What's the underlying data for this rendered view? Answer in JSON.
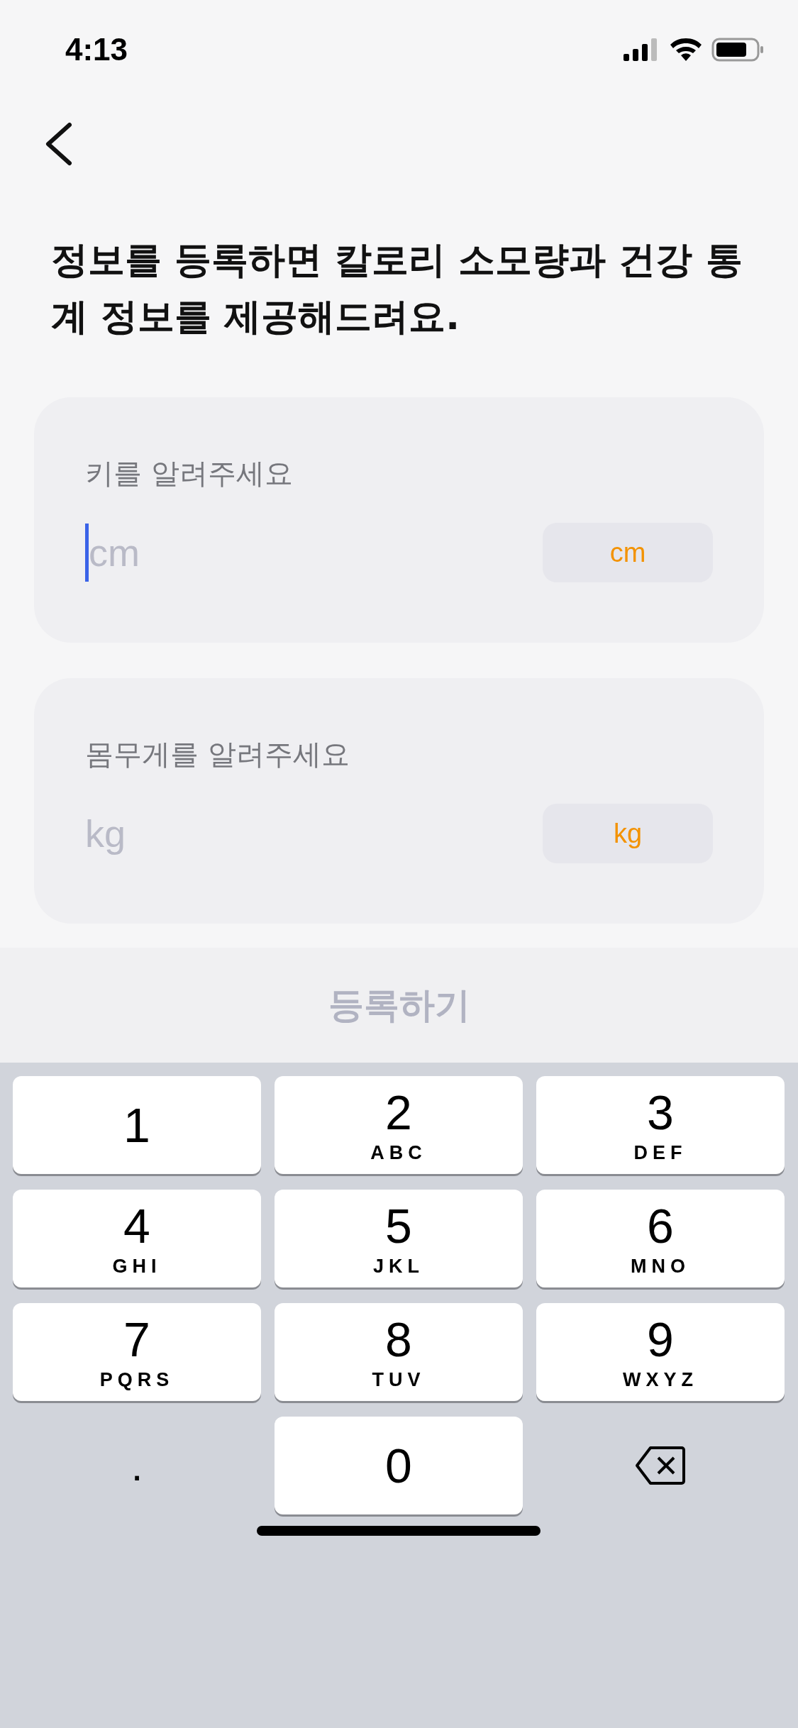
{
  "status_bar": {
    "time": "4:13"
  },
  "title": "정보를 등록하면 칼로리 소모량과 건강 통계 정보를 제공해드려요.",
  "fields": [
    {
      "label": "키를 알려주세요",
      "placeholder": "cm",
      "unit": "cm",
      "focused": true
    },
    {
      "label": "몸무게를 알려주세요",
      "placeholder": "kg",
      "unit": "kg",
      "focused": false
    }
  ],
  "submit": {
    "label": "등록하기",
    "disabled": true
  },
  "keypad": [
    {
      "kind": "digit",
      "digit": "1"
    },
    {
      "kind": "digit",
      "digit": "2",
      "letters": "ABC"
    },
    {
      "kind": "digit",
      "digit": "3",
      "letters": "DEF"
    },
    {
      "kind": "digit",
      "digit": "4",
      "letters": "GHI"
    },
    {
      "kind": "digit",
      "digit": "5",
      "letters": "JKL"
    },
    {
      "kind": "digit",
      "digit": "6",
      "letters": "MNO"
    },
    {
      "kind": "digit",
      "digit": "7",
      "letters": "PQRS"
    },
    {
      "kind": "digit",
      "digit": "8",
      "letters": "TUV"
    },
    {
      "kind": "digit",
      "digit": "9",
      "letters": "WXYZ"
    },
    {
      "kind": "symbol",
      "digit": "."
    },
    {
      "kind": "digit",
      "digit": "0"
    },
    {
      "kind": "delete"
    }
  ]
}
